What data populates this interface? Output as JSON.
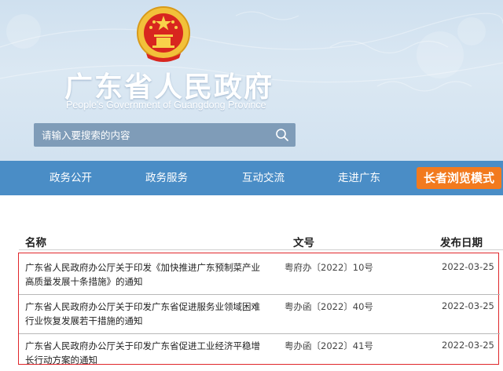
{
  "header": {
    "title": "广东省人民政府",
    "subtitle": "People's Government of Guangdong Province",
    "emblem_icon": "national-emblem-icon"
  },
  "search": {
    "placeholder": "请输入要搜索的内容",
    "icon": "search-icon"
  },
  "nav": {
    "items": [
      "政务公开",
      "政务服务",
      "互动交流",
      "走进广东"
    ],
    "elder_mode_label": "长者浏览模式"
  },
  "table": {
    "columns": {
      "name": "名称",
      "doc_no": "文号",
      "date": "发布日期"
    },
    "rows": [
      {
        "name_line1": "广东省人民政府办公厅关于印发《加快推进广东预制菜产业",
        "name_line2": "高质量发展十条措施》的通知",
        "doc_no": "粤府办〔2022〕10号",
        "date": "2022-03-25"
      },
      {
        "name_line1": "广东省人民政府办公厅关于印发广东省促进服务业领域困难",
        "name_line2": "行业恢复发展若干措施的通知",
        "doc_no": "粤办函〔2022〕40号",
        "date": "2022-03-25"
      },
      {
        "name_line1": "广东省人民政府办公厅关于印发广东省促进工业经济平稳增",
        "name_line2": "长行动方案的通知",
        "doc_no": "粤办函〔2022〕41号",
        "date": "2022-03-25"
      }
    ]
  },
  "colors": {
    "nav_bg": "#4a8dc6",
    "elder_button": "#f27a1e",
    "highlight_border": "#e0262b",
    "search_bg": "#7f9cb8"
  }
}
